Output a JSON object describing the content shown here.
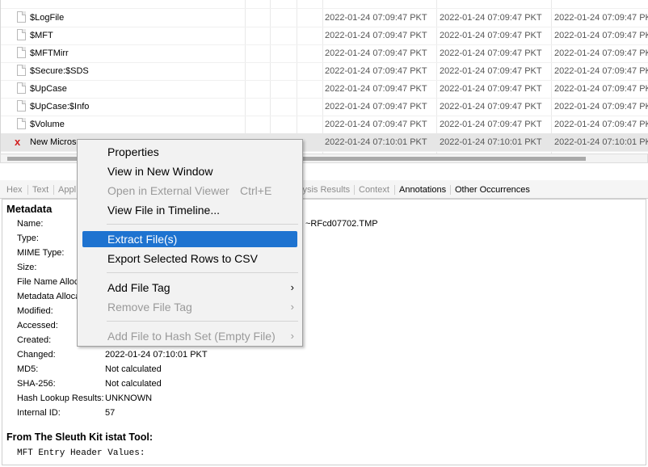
{
  "table": {
    "rows": [
      {
        "name": "$LogFile",
        "deleted": false,
        "d1": "2022-01-24 07:09:47 PKT",
        "d2": "2022-01-24 07:09:47 PKT",
        "d3": "2022-01-24 07:09:47 PK"
      },
      {
        "name": "$MFT",
        "deleted": false,
        "d1": "2022-01-24 07:09:47 PKT",
        "d2": "2022-01-24 07:09:47 PKT",
        "d3": "2022-01-24 07:09:47 PK"
      },
      {
        "name": "$MFTMirr",
        "deleted": false,
        "d1": "2022-01-24 07:09:47 PKT",
        "d2": "2022-01-24 07:09:47 PKT",
        "d3": "2022-01-24 07:09:47 PK"
      },
      {
        "name": "$Secure:$SDS",
        "deleted": false,
        "d1": "2022-01-24 07:09:47 PKT",
        "d2": "2022-01-24 07:09:47 PKT",
        "d3": "2022-01-24 07:09:47 PK"
      },
      {
        "name": "$UpCase",
        "deleted": false,
        "d1": "2022-01-24 07:09:47 PKT",
        "d2": "2022-01-24 07:09:47 PKT",
        "d3": "2022-01-24 07:09:47 PK"
      },
      {
        "name": "$UpCase:$Info",
        "deleted": false,
        "d1": "2022-01-24 07:09:47 PKT",
        "d2": "2022-01-24 07:09:47 PKT",
        "d3": "2022-01-24 07:09:47 PK"
      },
      {
        "name": "$Volume",
        "deleted": false,
        "d1": "2022-01-24 07:09:47 PKT",
        "d2": "2022-01-24 07:09:47 PKT",
        "d3": "2022-01-24 07:09:47 PK"
      },
      {
        "name": "New Microso",
        "deleted": true,
        "d1": "2022-01-24 07:10:01 PKT",
        "d2": "2022-01-24 07:10:01 PKT",
        "d3": "2022-01-24 07:10:01 PK"
      }
    ]
  },
  "tabs": {
    "hex": "Hex",
    "text": "Text",
    "appl": "Appl",
    "analysis": "lysis Results",
    "context": "Context",
    "annotations": "Annotations",
    "other": "Other Occurrences"
  },
  "metadata": {
    "title": "Metadata",
    "fields": [
      {
        "label": "Name:",
        "value": "~RFcd07702.TMP"
      },
      {
        "label": "Type:",
        "value": ""
      },
      {
        "label": "MIME Type:",
        "value": ""
      },
      {
        "label": "Size:",
        "value": ""
      },
      {
        "label": "File Name Alloca",
        "value": ""
      },
      {
        "label": "Metadata Alloca",
        "value": ""
      },
      {
        "label": "Modified:",
        "value": ""
      },
      {
        "label": "Accessed:",
        "value": ""
      },
      {
        "label": "Created:",
        "value": ""
      },
      {
        "label": "Changed:",
        "value": "2022-01-24 07:10:01 PKT"
      },
      {
        "label": "MD5:",
        "value": "Not calculated"
      },
      {
        "label": "SHA-256:",
        "value": "Not calculated"
      },
      {
        "label": "Hash Lookup Results:",
        "value": "UNKNOWN"
      },
      {
        "label": "Internal ID:",
        "value": "57"
      }
    ],
    "istat_title": "From The Sleuth Kit istat Tool:",
    "istat_line": "MFT Entry Header Values:"
  },
  "context_menu": {
    "properties": "Properties",
    "view_new_window": "View in New Window",
    "open_external": "Open in External Viewer",
    "open_external_shortcut": "Ctrl+E",
    "view_timeline": "View File in Timeline...",
    "extract": "Extract File(s)",
    "export_csv": "Export Selected Rows to CSV",
    "add_tag": "Add File Tag",
    "remove_tag": "Remove File Tag",
    "add_hash": "Add File to Hash Set (Empty File)",
    "highlighted_item": "Extract File(s)"
  },
  "colors": {
    "highlight": "#1e73d0",
    "deleted_icon": "#d21e1e"
  }
}
